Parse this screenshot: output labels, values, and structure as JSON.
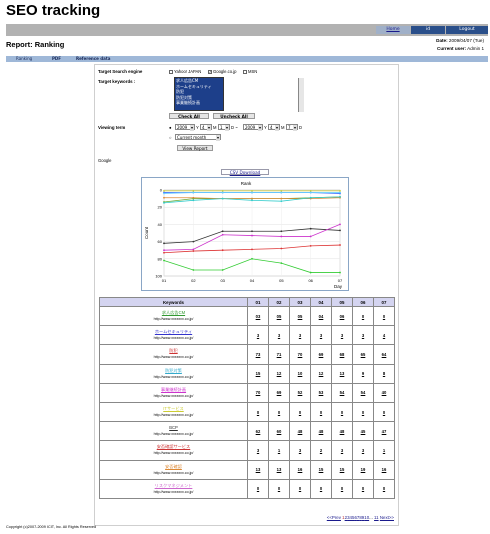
{
  "app": {
    "title": "SEO tracking"
  },
  "topbar": {
    "home": "Home",
    "id": "id",
    "logout": "Logout"
  },
  "report": {
    "title": "Report: Ranking"
  },
  "meta": {
    "date_label": "Date:",
    "date": "2009/04/07 (Tue)",
    "user_label": "Current user:",
    "user": "Admin 1"
  },
  "tabs": [
    "Ranking",
    "PDF",
    "Reference data"
  ],
  "form": {
    "engine_label": "Target Search engine",
    "engines": [
      {
        "name": "Yahoo! JAPAN",
        "checked": false
      },
      {
        "name": "Google.co.jp",
        "checked": true
      },
      {
        "name": "MSN",
        "checked": false
      }
    ],
    "keywords_label": "Target keywords :",
    "keyword_options": [
      "求人広告CM",
      "ホームセキュリティ",
      "防犯",
      "防犯対策",
      "事業継続計画"
    ],
    "check_all": "Check All",
    "uncheck_all": "Uncheck All",
    "viewing_label": "Viewing term",
    "from_year": "2009",
    "from_month": "4",
    "from_day": "1",
    "y": "Y",
    "m": "M",
    "d": "D",
    "range_sep": "D ~",
    "to_year": "2009",
    "to_month": "4",
    "to_day": "7",
    "preset": "Current month",
    "view_report": "View Report"
  },
  "engine_caption": "Google",
  "csv_download": "CSV Download",
  "chart_data": {
    "type": "line",
    "title": "Rank",
    "xlabel": "Day",
    "ylabel": "Count",
    "x": [
      "01",
      "02",
      "03",
      "04",
      "05",
      "06",
      "07"
    ],
    "ylim": [
      0,
      100
    ],
    "y_inverted": true,
    "y_ticks": [
      0,
      20,
      40,
      60,
      80,
      100
    ],
    "series": [
      {
        "color": "#333333",
        "values": [
          62,
          60,
          48,
          48,
          48,
          45,
          47
        ]
      },
      {
        "color": "#cc33cc",
        "values": [
          70,
          69,
          52,
          53,
          54,
          54,
          40
        ]
      },
      {
        "color": "#dd3333",
        "values": [
          73,
          71,
          70,
          69,
          68,
          65,
          64
        ]
      },
      {
        "color": "#33cc33",
        "values": [
          82,
          93,
          93,
          80,
          85,
          96,
          96
        ]
      },
      {
        "color": "#3366ff",
        "values": [
          3,
          3,
          3,
          3,
          3,
          3,
          4
        ]
      },
      {
        "color": "#66aa33",
        "values": [
          14,
          10,
          10,
          10,
          10,
          9,
          8
        ]
      },
      {
        "color": "#dd8833",
        "values": [
          9,
          9,
          10,
          10,
          10,
          10,
          9
        ]
      },
      {
        "color": "#33cccc",
        "values": [
          15,
          12,
          10,
          12,
          13,
          9,
          8
        ]
      },
      {
        "color": "#cccc33",
        "values": [
          1,
          1,
          1,
          1,
          1,
          1,
          1
        ]
      },
      {
        "color": "#66ccff",
        "values": [
          4,
          3,
          3,
          3,
          3,
          3,
          3
        ]
      }
    ]
  },
  "table": {
    "headers": [
      "Keywords",
      "01",
      "02",
      "03",
      "04",
      "05",
      "06",
      "07"
    ],
    "rows": [
      {
        "keyword": "求人広告CM",
        "color": "#339933",
        "url": "http://www.xxxxxxx.co.jp/",
        "ranks": [
          "03",
          "05",
          "05",
          "04",
          "06",
          "0",
          "0"
        ]
      },
      {
        "keyword": "ホームセキュリティ",
        "color": "#3333cc",
        "url": "http://www.xxxxxxx.co.jp/",
        "ranks": [
          "3",
          "3",
          "3",
          "3",
          "3",
          "3",
          "4"
        ]
      },
      {
        "keyword": "防犯",
        "color": "#cc3333",
        "url": "http://www.xxxxxxx.co.jp/",
        "ranks": [
          "73",
          "71",
          "70",
          "69",
          "68",
          "65",
          "64"
        ]
      },
      {
        "keyword": "防犯対策",
        "color": "#33aacc",
        "url": "http://www.xxxxxxx.co.jp/",
        "ranks": [
          "15",
          "12",
          "10",
          "12",
          "13",
          "9",
          "8"
        ]
      },
      {
        "keyword": "事業継続計画",
        "color": "#cc33cc",
        "url": "http://www.xxxxxxx.co.jp/",
        "ranks": [
          "70",
          "69",
          "52",
          "53",
          "54",
          "54",
          "40"
        ]
      },
      {
        "keyword": "ITサービス",
        "color": "#cccc33",
        "url": "http://www.xxxxxxx.co.jp/",
        "ranks": [
          "0",
          "0",
          "0",
          "0",
          "0",
          "0",
          "0"
        ]
      },
      {
        "keyword": "BCP",
        "color": "#333333",
        "url": "http://www.xxxxxxx.co.jp/",
        "ranks": [
          "62",
          "60",
          "48",
          "48",
          "48",
          "45",
          "47"
        ]
      },
      {
        "keyword": "安否確認サービス",
        "color": "#cc3333",
        "url": "http://www.xxxxxxx.co.jp/",
        "ranks": [
          "3",
          "1",
          "3",
          "2",
          "3",
          "3",
          "1"
        ]
      },
      {
        "keyword": "安否確認",
        "color": "#dd8833",
        "url": "http://www.xxxxxxx.co.jp/",
        "ranks": [
          "13",
          "13",
          "16",
          "15",
          "15",
          "19",
          "16"
        ]
      },
      {
        "keyword": "リスクマネジメント",
        "color": "#cc66cc",
        "url": "http://www.xxxxxxx.co.jp/",
        "ranks": [
          "0",
          "0",
          "0",
          "0",
          "0",
          "0",
          "0"
        ]
      }
    ]
  },
  "pager": {
    "prev": "<<Prev",
    "pages": [
      "1",
      "2",
      "3",
      "4",
      "5",
      "6",
      "7",
      "8",
      "9",
      "10"
    ],
    "ellipsis": "...",
    "last": "11",
    "next": "Next>>",
    "current": "1"
  },
  "footer": {
    "copyright": "Copyright (c)2007-2009 ICIT, Inc. All Rights Reserved"
  }
}
